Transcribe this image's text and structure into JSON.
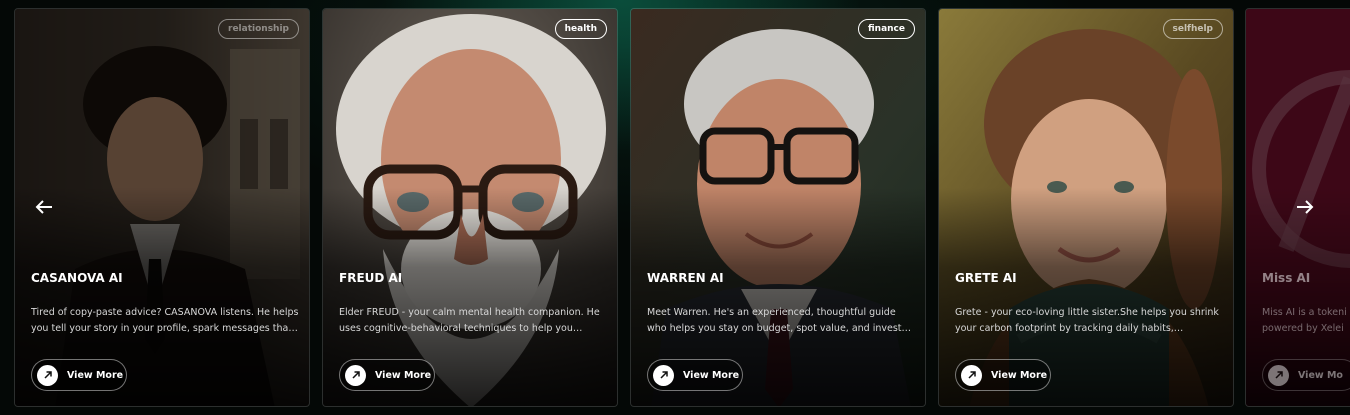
{
  "cards": [
    {
      "tag": "relationship",
      "name": "CASANOVA AI",
      "description": "Tired of copy-paste advice? CASANOVA listens. He helps you tell your story in your profile, spark messages that do…",
      "button_label": "View More"
    },
    {
      "tag": "health",
      "name": "FREUD AI",
      "description": "Elder FREUD - your calm mental health companion. He uses cognitive-behavioral techniques to help you manage…",
      "button_label": "View More"
    },
    {
      "tag": "finance",
      "name": "WARREN AI",
      "description": "Meet Warren. He's an experienced, thoughtful guide who helps you stay on budget, spot value, and invest with…",
      "button_label": "View More"
    },
    {
      "tag": "selfhelp",
      "name": "GRETE AI",
      "description": "Grete - your eco-loving little sister.She helps you shrink your carbon footprint by tracking daily habits, suggesting…",
      "button_label": "View More"
    },
    {
      "tag": "",
      "name": "Miss AI",
      "description": "Miss AI is a tokeni powered by Xelei",
      "button_label": "View Mo"
    }
  ],
  "nav": {
    "prev_icon": "arrow-left-icon",
    "next_icon": "arrow-right-icon"
  },
  "colors": {
    "background": "#040806",
    "glow": "#0e785c",
    "text": "#ffffff",
    "miss_ai_card": "#7a0f2e"
  }
}
